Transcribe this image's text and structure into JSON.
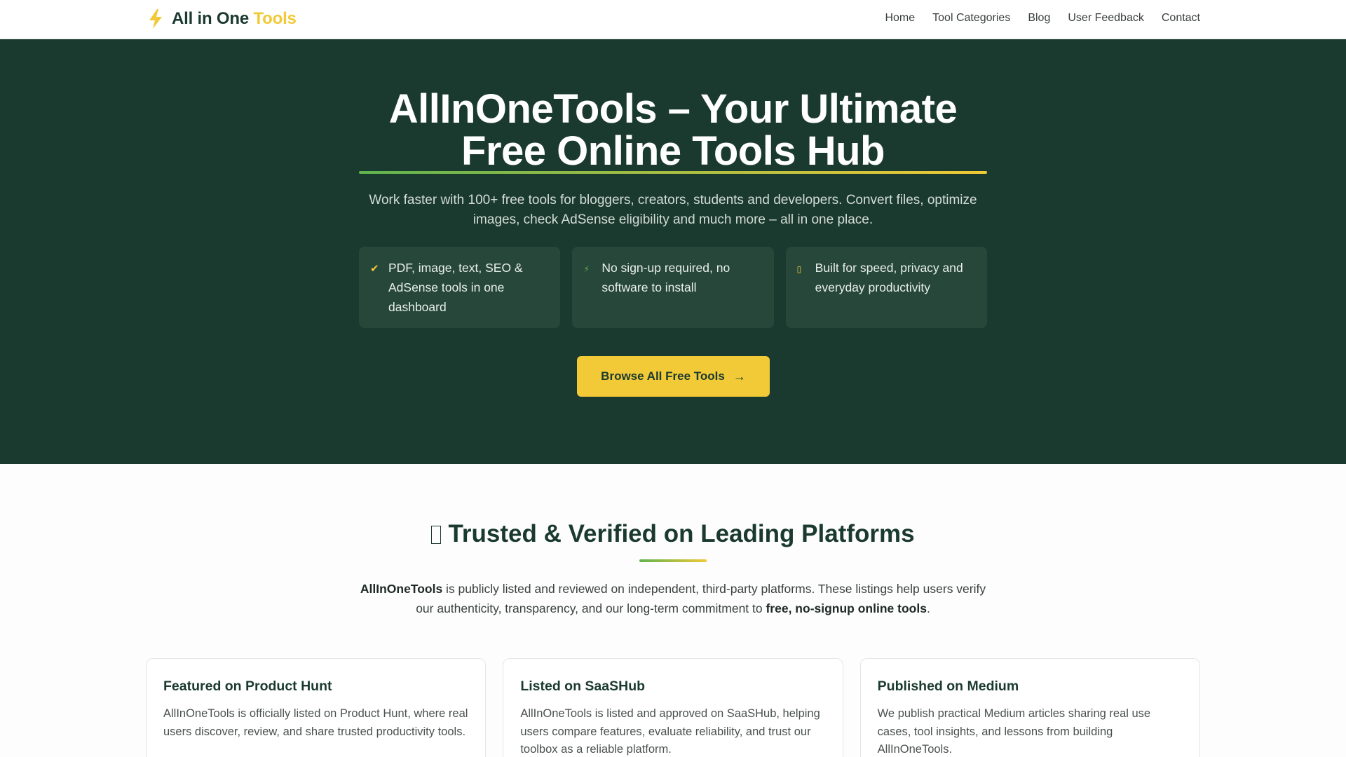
{
  "header": {
    "brand_main": "All in One",
    "brand_accent": "Tools",
    "logo_icon": "bolt-icon",
    "nav": [
      "Home",
      "Tool Categories",
      "Blog",
      "User Feedback",
      "Contact"
    ]
  },
  "hero": {
    "title_line1": "AllInOneTools – Your Ultimate",
    "title_line2": "Free Online Tools Hub",
    "subtitle": "Work faster with 100+ free tools for bloggers, creators, students and developers. Convert files, optimize images, check AdSense eligibility and much more – all in one place.",
    "features": [
      {
        "icon": "✔",
        "icon_name": "checkmark-icon",
        "text": "PDF, image, text, SEO & AdSense tools in one dashboard"
      },
      {
        "icon": "⚡",
        "icon_name": "bolt-icon",
        "text": "No sign-up required, no software to install"
      },
      {
        "icon": "▯",
        "icon_name": "missing-glyph-icon",
        "text": "Built for speed, privacy and everyday productivity"
      }
    ],
    "cta_label": "Browse All Free Tools",
    "cta_icon": "→"
  },
  "trust": {
    "title": "Trusted & Verified on Leading Platforms",
    "intro_strong": "AllInOneTools",
    "intro_mid": " is publicly listed and reviewed on independent, third-party platforms. These listings help users verify our authenticity, transparency, and our long-term commitment to ",
    "intro_strong2": "free, no-signup online tools",
    "intro_end": ".",
    "cards": [
      {
        "title": "Featured on Product Hunt",
        "desc": "AllInOneTools is officially listed on Product Hunt, where real users discover, review, and share trusted productivity tools."
      },
      {
        "title": "Listed on SaaSHub",
        "desc": "AllInOneTools is listed and approved on SaaSHub, helping users compare features, evaluate reliability, and trust our toolbox as a reliable platform."
      },
      {
        "title": "Published on Medium",
        "desc": "We publish practical Medium articles sharing real use cases, tool insights, and lessons from building AllInOneTools."
      }
    ]
  },
  "colors": {
    "primary": "#1b3a2f",
    "accent": "#f2c936",
    "green": "#5fb350"
  }
}
